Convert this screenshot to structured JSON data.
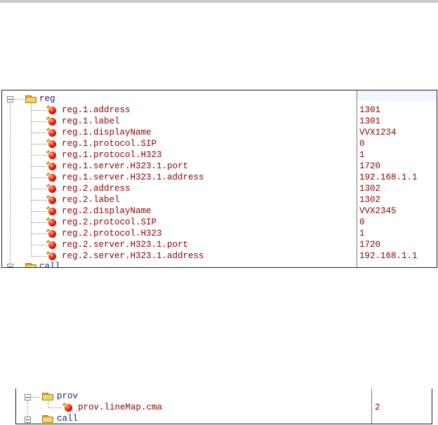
{
  "panel1": {
    "root_folder": "reg",
    "items": [
      {
        "key": "reg.1.address",
        "value": "1301"
      },
      {
        "key": "reg.1.label",
        "value": "1301"
      },
      {
        "key": "reg.1.displayName",
        "value": "VVX1234"
      },
      {
        "key": "reg.1.protocol.SIP",
        "value": "0"
      },
      {
        "key": "reg.1.protocol.H323",
        "value": "1"
      },
      {
        "key": "reg.1.server.H323.1.port",
        "value": "1720"
      },
      {
        "key": "reg.1.server.H323.1.address",
        "value": "192.168.1.1"
      },
      {
        "key": "reg.2.address",
        "value": "1302"
      },
      {
        "key": "reg.2.label",
        "value": "1302"
      },
      {
        "key": "reg.2.displayName",
        "value": "VVX2345"
      },
      {
        "key": "reg.2.protocol.SIP",
        "value": "0"
      },
      {
        "key": "reg.2.protocol.H323",
        "value": "1"
      },
      {
        "key": "reg.2.server.H323.1.port",
        "value": "1720"
      },
      {
        "key": "reg.2.server.H323.1.address",
        "value": "192.168.1.1"
      }
    ],
    "next_folder": "call"
  },
  "panel2": {
    "root_folder": "prov",
    "items": [
      {
        "key": "prov.lineMap.cma",
        "value": "2"
      }
    ],
    "next_folder": "call"
  },
  "colors": {
    "key_text": "#8b0000",
    "folder_text": "#1a1a7a",
    "value_header_bg": "#f1f7ff"
  },
  "icons": {
    "folder": "folder-icon",
    "parameter": "red-ball-parameter-icon",
    "expander": "collapse-minus-icon"
  }
}
